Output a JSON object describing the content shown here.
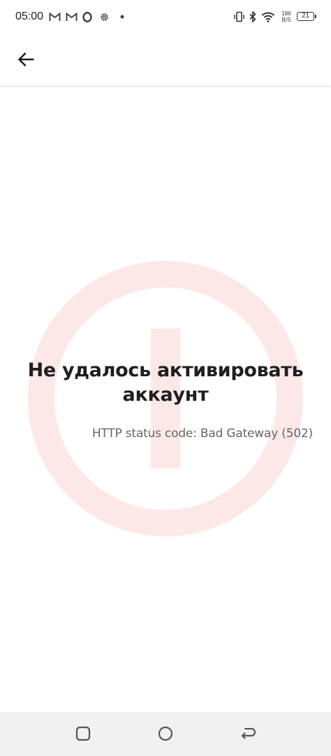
{
  "status_bar": {
    "time": "05:00",
    "net_speed_value": "186",
    "net_speed_unit": "B/S",
    "battery_level": "21"
  },
  "app_bar": {
    "back_icon": "arrow-left-icon"
  },
  "error": {
    "title": "Не удалось активировать аккаунт",
    "detail": "HTTP status code: Bad Gateway (502)",
    "background_icon": "alert-circle-icon",
    "accent_color": "#fde8e8"
  },
  "nav_bar": {
    "recents_icon": "square-icon",
    "home_icon": "circle-icon",
    "back_icon": "return-arrow-icon"
  }
}
